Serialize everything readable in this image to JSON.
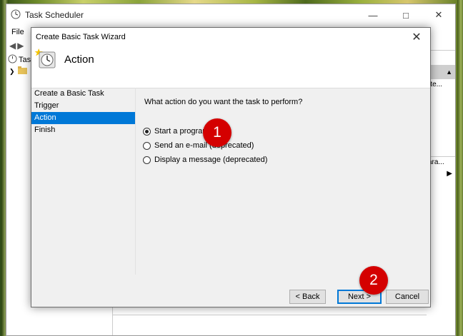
{
  "app": {
    "title": "Task Scheduler",
    "menu": [
      "File"
    ],
    "tree_item": "Task",
    "right_pane": {
      "text1": "rte...",
      "text2": "ara..."
    }
  },
  "wizard": {
    "title": "Create Basic Task Wizard",
    "heading": "Action",
    "steps": [
      {
        "label": "Create a Basic Task",
        "active": false
      },
      {
        "label": "Trigger",
        "active": false
      },
      {
        "label": "Action",
        "active": true
      },
      {
        "label": "Finish",
        "active": false
      }
    ],
    "question": "What action do you want the task to perform?",
    "options": [
      {
        "label": "Start a program",
        "selected": true
      },
      {
        "label": "Send an e-mail (deprecated)",
        "selected": false
      },
      {
        "label": "Display a message (deprecated)",
        "selected": false
      }
    ],
    "buttons": {
      "back": "< Back",
      "next": "Next >",
      "cancel": "Cancel"
    }
  },
  "annotations": {
    "badge1": "1",
    "badge2": "2",
    "badge_color": "#d40000"
  },
  "colors": {
    "selection": "#0078d7"
  },
  "icons": [
    "task-scheduler-icon",
    "clock-icon",
    "folder-icon",
    "close-icon",
    "minimize-icon",
    "maximize-icon"
  ]
}
